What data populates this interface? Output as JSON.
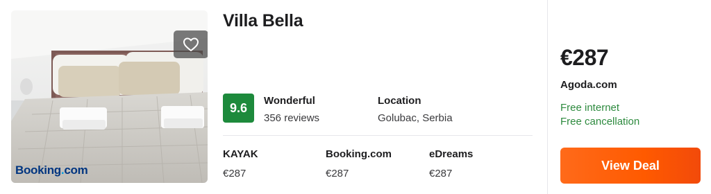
{
  "hotel": {
    "name": "Villa Bella",
    "image_logo": "Booking.com",
    "rating": {
      "score": "9.6",
      "label": "Wonderful",
      "reviews": "356 reviews",
      "score_color": "#1d8a3c"
    },
    "location": {
      "label": "Location",
      "value": "Golubac, Serbia"
    }
  },
  "providers": [
    {
      "name": "KAYAK",
      "price": "€287"
    },
    {
      "name": "Booking.com",
      "price": "€287"
    },
    {
      "name": "eDreams",
      "price": "€287"
    }
  ],
  "deal": {
    "price": "€287",
    "site": "Agoda.com",
    "amenities": [
      "Free internet",
      "Free cancellation"
    ],
    "button_label": "View Deal",
    "button_color": "#ff5a00"
  },
  "icons": {
    "favorite": "heart-icon"
  }
}
